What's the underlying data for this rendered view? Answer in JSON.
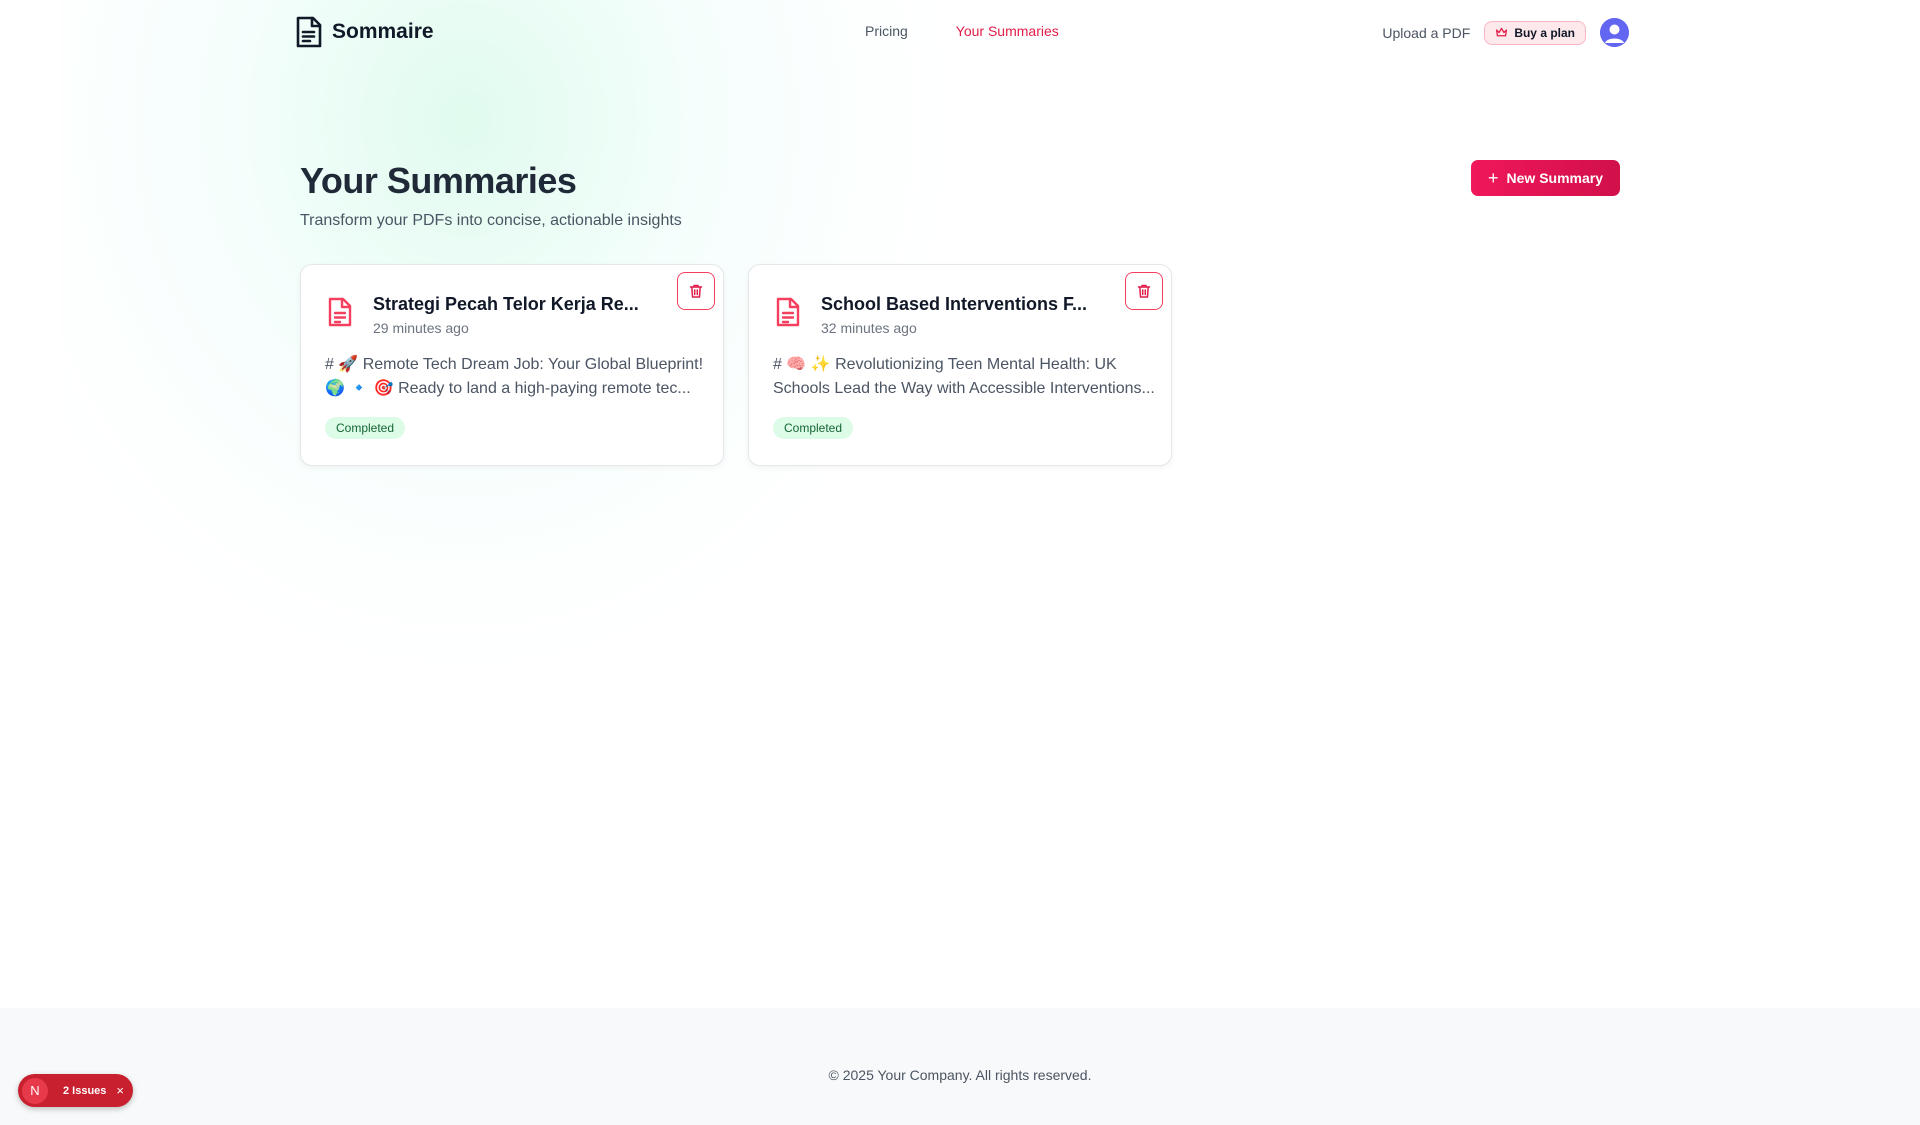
{
  "nav": {
    "brand": "Sommaire",
    "links": [
      {
        "label": "Pricing",
        "active": false
      },
      {
        "label": "Your Summaries",
        "active": true
      }
    ],
    "upload_label": "Upload a PDF",
    "plan_label": "Buy a plan"
  },
  "header": {
    "title": "Your Summaries",
    "subtitle": "Transform your PDFs into concise, actionable insights",
    "new_button_label": "New Summary"
  },
  "summaries": [
    {
      "title": "Strategi Pecah Telor Kerja Re...",
      "time": "29 minutes ago",
      "preview_line1": "# 🚀 Remote Tech Dream Job: Your Global Blueprint!",
      "preview_line2": "🌍 🔹 🎯 Ready to land a high-paying remote tec...",
      "status": "Completed"
    },
    {
      "title": "School Based Interventions F...",
      "time": "32 minutes ago",
      "preview_line1": "# 🧠 ✨ Revolutionizing Teen Mental Health: UK",
      "preview_line2": "Schools Lead the Way with Accessible Interventions...",
      "status": "Completed"
    }
  ],
  "footer": {
    "copyright": "© 2025 Your Company. All rights reserved."
  },
  "dev_overlay": {
    "initial": "N",
    "issues_label": "2 Issues",
    "close_glyph": "×"
  },
  "colors": {
    "accent": "#e11d48",
    "badge_bg": "#dcfce7",
    "badge_text": "#166534"
  }
}
